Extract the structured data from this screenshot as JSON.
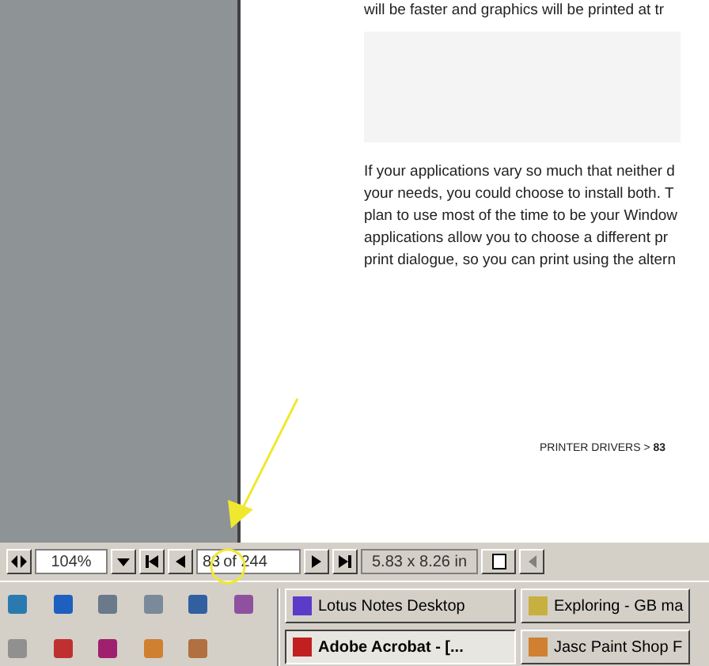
{
  "document": {
    "top_line": "will be faster and graphics will be printed at tr",
    "paragraph": [
      "If your applications vary so much that neither d",
      "your needs, you could choose to install both. T",
      "plan to use most of the time to be your Window",
      "applications allow you to choose a different pr",
      "print dialogue, so you can print using the altern"
    ],
    "footer": "PRINTER DRIVERS > **83**"
  },
  "status_bar": {
    "zoom": "104%",
    "page": "83",
    "page_total": "of 244",
    "page_size": "5.83 x 8.26 in"
  },
  "taskbar": {
    "tasks": [
      {
        "label": "Lotus Notes Desktop",
        "selected": false
      },
      {
        "label": "Exploring - GB ma",
        "selected": false
      },
      {
        "label": "Adobe Acrobat - [...",
        "selected": true
      },
      {
        "label": "Jasc Paint Shop F",
        "selected": false
      }
    ]
  }
}
